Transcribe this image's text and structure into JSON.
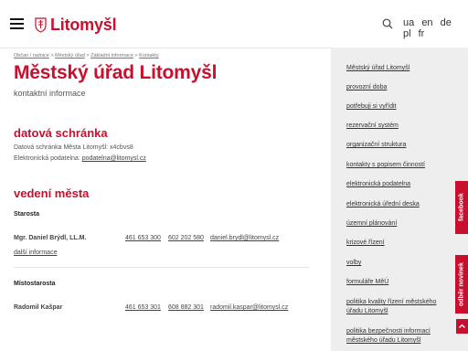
{
  "header": {
    "logo_text": "Litomyšl",
    "languages": [
      "ua",
      "en",
      "de",
      "pl",
      "fr"
    ]
  },
  "breadcrumb": [
    "Občan / radnice",
    "Městský úřad",
    "Základní informace",
    "Kontakty"
  ],
  "page": {
    "title": "Městský úřad Litomyšl",
    "subtitle": "kontaktní informace"
  },
  "datova_schranka": {
    "heading": "datová schránka",
    "line1": "Datová schránka Města Litomyšl: x4cbvs8",
    "line2_label": "Elektronická podatelna:",
    "line2_email": "podatelna@litomysl.cz"
  },
  "vedeni": {
    "heading": "vedení města",
    "starosta_role": "Starosta",
    "starosta_name": "Mgr. Daniel Brýdl, LL.M.",
    "starosta_phone1": "461 653 300",
    "starosta_phone2": "602 202 580",
    "starosta_email": "daniel.brydl@litomysl.cz",
    "more_label": "další informace",
    "mistostarosta_role": "Místostarosta",
    "mistostarosta_name": "Radomil Kašpar",
    "mistostarosta_phone1": "461 653 301",
    "mistostarosta_phone2": "608 882 301",
    "mistostarosta_email": "radomil.kaspar@litomysl.cz"
  },
  "sidebar": {
    "items": [
      "Městský úřad Litomyšl",
      "provozní doba",
      "potřebuji si vyřídit",
      "rezervační systém",
      "organizační struktura",
      "kontakty s popisem činností",
      "elektronická podatelna",
      "elektronická úřední deska",
      "územní plánování",
      "krizové řízení",
      "volby",
      "formuláře MěÚ",
      "politika kvality řízení městského úřadu Litomyšl",
      "politika bezpečnosti informací městského úřadu Litomyšl"
    ]
  },
  "tabs": {
    "facebook": "facebook",
    "newsletter": "odběr novinek"
  },
  "colors": {
    "brand": "#c8102e",
    "sidebar_bg": "#eeeeee"
  }
}
